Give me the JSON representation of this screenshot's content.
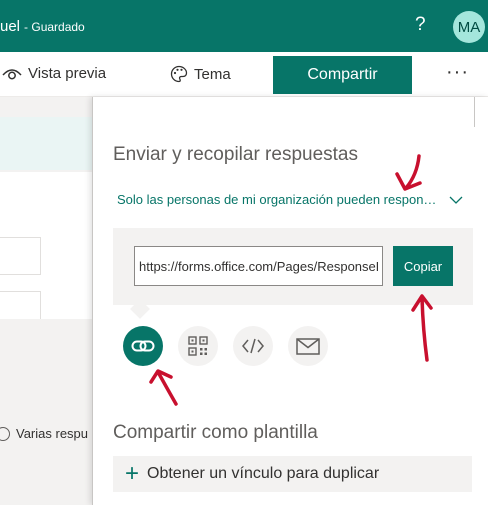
{
  "header": {
    "form_title": "uel",
    "status": "- Guardado",
    "help_label": "?",
    "avatar_initials": "MA"
  },
  "toolbar": {
    "preview_label": "Vista previa",
    "theme_label": "Tema",
    "share_label": "Compartir",
    "more_label": "···"
  },
  "left_pane": {
    "option_label": "Varias respu"
  },
  "share_panel": {
    "heading": "Enviar y recopilar respuestas",
    "permission": "Solo las personas de mi organización pueden responder",
    "url": "https://forms.office.com/Pages/ResponsePage.aspx",
    "copy_label": "Copiar",
    "send_options": [
      "link-icon",
      "qr-code-icon",
      "embed-code-icon",
      "email-icon"
    ],
    "template_heading": "Compartir como plantilla",
    "duplicate_label": "Obtener un vínculo para duplicar"
  },
  "colors": {
    "brand": "#077568",
    "avatar_bg": "#a4e6dc",
    "annotation": "#c8102e"
  }
}
